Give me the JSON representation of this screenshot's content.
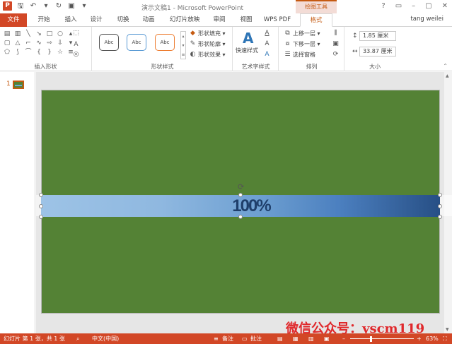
{
  "window": {
    "title": "演示文稿1 - Microsoft PowerPoint",
    "context_title": "绘图工具",
    "app_logo": "P",
    "user": "tang weilei",
    "controls": [
      "?",
      "▭",
      "–",
      "▢",
      "✕"
    ]
  },
  "qat": {
    "save_icon": "save-icon",
    "undo_icon": "undo-icon",
    "redo_icon": "redo-icon",
    "present_icon": "present-icon"
  },
  "tabs": [
    {
      "label": "文件"
    },
    {
      "label": "开始"
    },
    {
      "label": "插入"
    },
    {
      "label": "设计"
    },
    {
      "label": "切换"
    },
    {
      "label": "动画"
    },
    {
      "label": "幻灯片放映"
    },
    {
      "label": "审阅"
    },
    {
      "label": "视图"
    },
    {
      "label": "WPS PDF"
    },
    {
      "label": "格式"
    }
  ],
  "ribbon": {
    "insert_shapes": {
      "label": "插入形状"
    },
    "shape_styles": {
      "label": "形状样式",
      "samples": [
        "Abc",
        "Abc",
        "Abc"
      ],
      "fill": "形状填充 ▾",
      "outline": "形状轮廓 ▾",
      "effects": "形状效果 ▾"
    },
    "wordart": {
      "label": "艺术字样式",
      "quick_styles": "快速样式"
    },
    "arrange": {
      "label": "排列",
      "bring_forward": "上移一层 ▾",
      "send_backward": "下移一层 ▾",
      "selection_pane": "选择窗格"
    },
    "size": {
      "label": "大小",
      "height": "1.85 厘米",
      "width": "33.87 厘米"
    }
  },
  "slides_pane": {
    "slide_number": "1"
  },
  "slide": {
    "bar_text": "100%"
  },
  "watermark": "微信公众号：yscm119",
  "status": {
    "slide_info": "幻灯片 第 1 张，共 1 张",
    "language": "中文(中国)",
    "notes": "备注",
    "comments": "批注",
    "zoom": "63%"
  },
  "colors": {
    "accent": "#d24726",
    "slide_bg": "#548235",
    "bar_start": "#9dc3e6",
    "bar_end": "#274f85"
  }
}
